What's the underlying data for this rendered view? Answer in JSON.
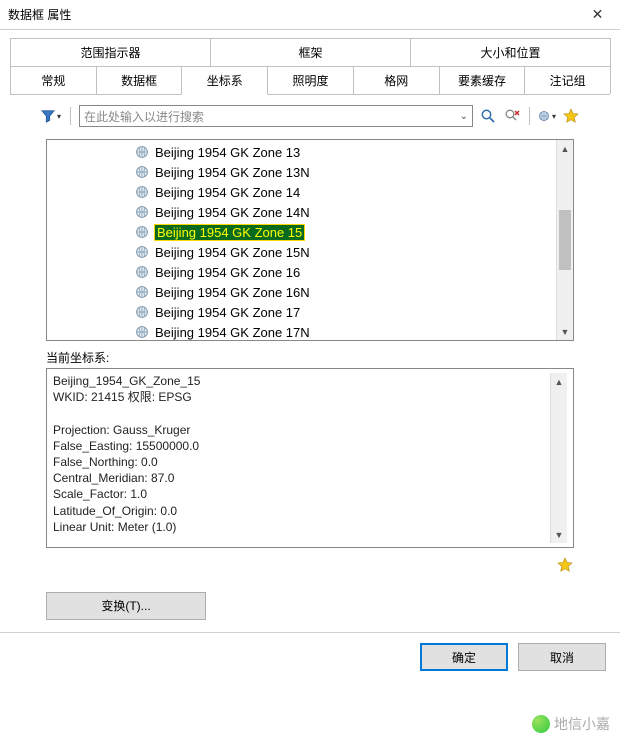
{
  "window": {
    "title": "数据框 属性"
  },
  "tabs_row1": [
    {
      "label": "范围指示器"
    },
    {
      "label": "框架"
    },
    {
      "label": "大小和位置"
    }
  ],
  "tabs_row2": [
    {
      "label": "常规"
    },
    {
      "label": "数据框"
    },
    {
      "label": "坐标系",
      "active": true
    },
    {
      "label": "照明度"
    },
    {
      "label": "格网"
    },
    {
      "label": "要素缓存"
    },
    {
      "label": "注记组"
    }
  ],
  "search": {
    "placeholder": "在此处输入以进行搜索"
  },
  "crs_items": [
    {
      "label": "Beijing 1954 GK Zone 13"
    },
    {
      "label": "Beijing 1954 GK Zone 13N"
    },
    {
      "label": "Beijing 1954 GK Zone 14"
    },
    {
      "label": "Beijing 1954 GK Zone 14N"
    },
    {
      "label": "Beijing 1954 GK Zone 15",
      "selected": true
    },
    {
      "label": "Beijing 1954 GK Zone 15N"
    },
    {
      "label": "Beijing 1954 GK Zone 16"
    },
    {
      "label": "Beijing 1954 GK Zone 16N"
    },
    {
      "label": "Beijing 1954 GK Zone 17"
    },
    {
      "label": "Beijing 1954 GK Zone 17N"
    }
  ],
  "current_label": "当前坐标系:",
  "details": "Beijing_1954_GK_Zone_15\nWKID: 21415 权限: EPSG\n\nProjection: Gauss_Kruger\nFalse_Easting: 15500000.0\nFalse_Northing: 0.0\nCentral_Meridian: 87.0\nScale_Factor: 1.0\nLatitude_Of_Origin: 0.0\nLinear Unit: Meter (1.0)",
  "transform_btn": "变换(T)...",
  "footer": {
    "ok": "确定",
    "cancel": "取消"
  },
  "watermark": "地信小嘉"
}
